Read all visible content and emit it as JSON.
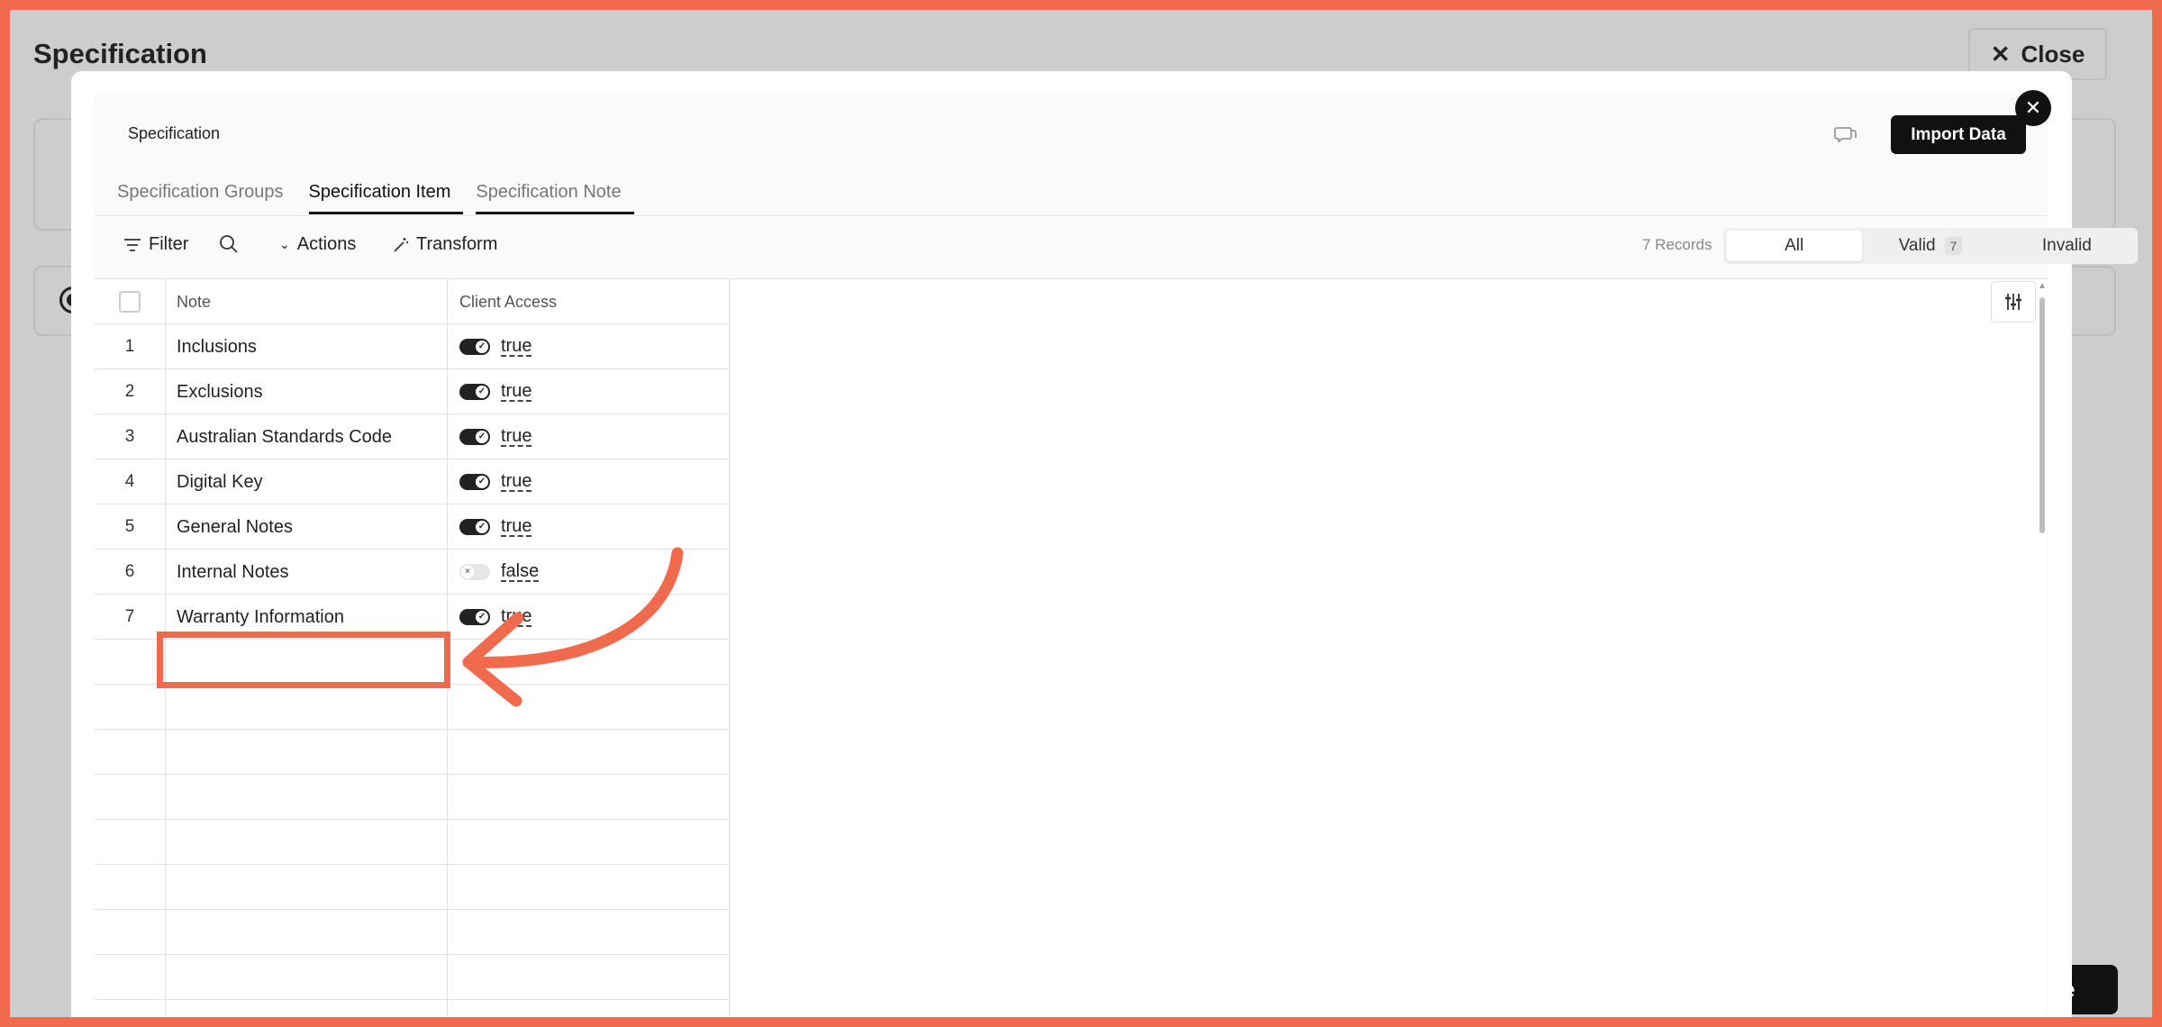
{
  "background": {
    "title": "Specification",
    "close_label": "Close",
    "save_partial": "e"
  },
  "modal": {
    "title": "Specification",
    "import_label": "Import Data",
    "tabs": [
      {
        "label": "Specification Groups"
      },
      {
        "label": "Specification Item"
      },
      {
        "label": "Specification Note"
      }
    ],
    "toolbar": {
      "filter_label": "Filter",
      "actions_label": "Actions",
      "transform_label": "Transform",
      "records": "7 Records",
      "seg_all": "All",
      "seg_valid": "Valid",
      "seg_valid_count": "7",
      "seg_invalid": "Invalid"
    },
    "columns": {
      "note": "Note",
      "client_access": "Client Access"
    },
    "rows": [
      {
        "num": "1",
        "note": "Inclusions",
        "access": "true"
      },
      {
        "num": "2",
        "note": "Exclusions",
        "access": "true"
      },
      {
        "num": "3",
        "note": "Australian Standards Code",
        "access": "true"
      },
      {
        "num": "4",
        "note": "Digital Key",
        "access": "true"
      },
      {
        "num": "5",
        "note": "General Notes",
        "access": "true"
      },
      {
        "num": "6",
        "note": "Internal Notes",
        "access": "false"
      },
      {
        "num": "7",
        "note": "Warranty Information",
        "access": "true"
      }
    ]
  },
  "colors": {
    "annotation": "#f06a4d",
    "primary": "#111111"
  },
  "icons": [
    "close-icon",
    "feedback-icon",
    "filter-icon",
    "search-icon",
    "chevron-down-icon",
    "magic-wand-icon",
    "settings-sliders-icon"
  ]
}
